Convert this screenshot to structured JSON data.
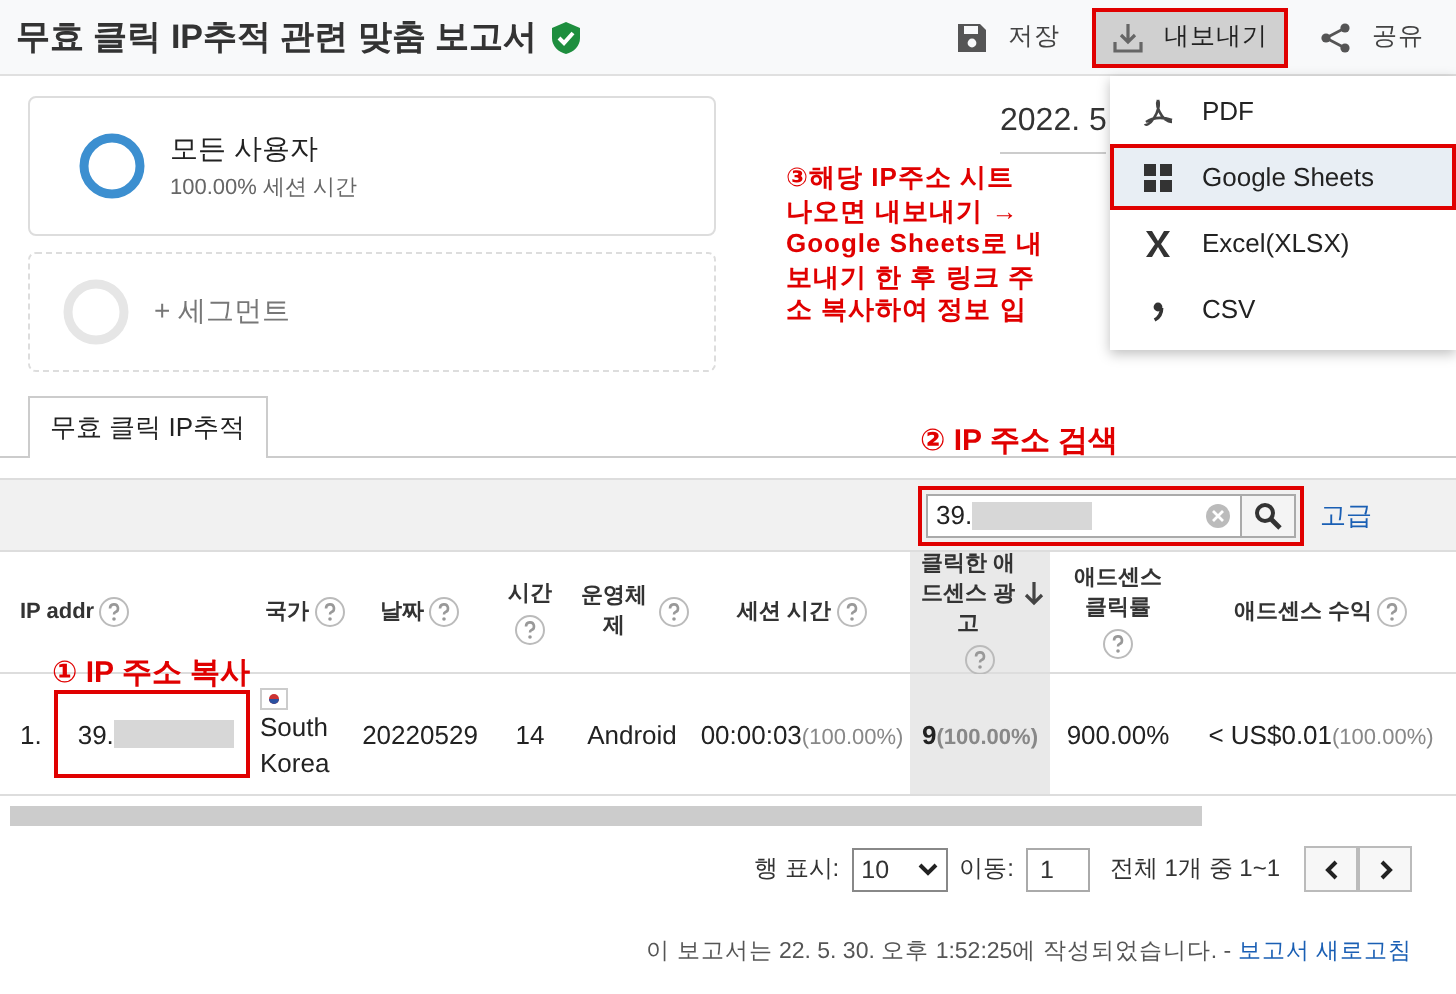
{
  "header": {
    "title": "무효 클릭 IP추적 관련 맞춤 보고서",
    "verified": true,
    "actions": [
      {
        "kind": "save",
        "label": "저장",
        "selected": false,
        "annotated": false
      },
      {
        "kind": "export",
        "label": "내보내기",
        "selected": true,
        "annotated": true
      },
      {
        "kind": "share",
        "label": "공유",
        "selected": false,
        "annotated": false
      }
    ]
  },
  "segments": [
    {
      "kind": "active",
      "name": "모든 사용자",
      "detail": "100.00% 세션 시간"
    },
    {
      "kind": "add",
      "name": "+ 세그먼트"
    }
  ],
  "date_range": "2022. 5",
  "export_menu": {
    "items": [
      {
        "kind": "pdf",
        "label": "PDF",
        "selected": false,
        "annotated": false
      },
      {
        "kind": "sheets",
        "label": "Google Sheets",
        "selected": true,
        "annotated": true
      },
      {
        "kind": "excel",
        "label": "Excel(XLSX)",
        "selected": false,
        "annotated": false
      },
      {
        "kind": "csv",
        "label": "CSV",
        "selected": false,
        "annotated": false
      }
    ]
  },
  "annotations": [
    {
      "lines": [
        "③해당 IP주소 시트",
        "나오면 내보내기 →",
        "Google Sheets로 내",
        "보내기 한 후 링크 주",
        "소 복사하여 정보 입"
      ]
    },
    {
      "lines": [
        "② IP 주소 검색"
      ]
    },
    {
      "lines": [
        "① IP 주소 복사"
      ]
    }
  ],
  "tabs": [
    {
      "label": "무효 클릭 IP추적",
      "selected": true
    }
  ],
  "search": {
    "value": "39.",
    "redacted": true,
    "annotated": true
  },
  "advanced_link": "고급",
  "table": {
    "columns": [
      {
        "label": "IP addr",
        "sorted": false
      },
      {
        "label": "국가",
        "sorted": false
      },
      {
        "label": "날짜",
        "sorted": false
      },
      {
        "label": "시간",
        "sorted": false
      },
      {
        "label": "운영체제",
        "sorted": false
      },
      {
        "label": "세션 시간",
        "sorted": false
      },
      {
        "label": "클릭한 애드센스 광고",
        "sorted": true
      },
      {
        "label": "애드센스 클릭률",
        "sorted": false
      },
      {
        "label": "애드센스 수익",
        "sorted": false
      }
    ],
    "rows": [
      {
        "index": "1.",
        "ip": "39.",
        "redacted": true,
        "annotated": true,
        "country": "South Korea",
        "date": "20220529",
        "hour": "14",
        "os": "Android",
        "session": {
          "value": "00:00:03",
          "share": "(100.00%)"
        },
        "clicks": {
          "value": "9",
          "share": "(100.00%)"
        },
        "ctr": "900.00%",
        "revenue": {
          "value": "< US$0.01",
          "share": "(100.00%)"
        }
      }
    ]
  },
  "pager": {
    "rows_label": "행 표시:",
    "rows_value": "10",
    "goto_label": "이동:",
    "goto_value": "1",
    "range": "전체 1개 중 1~1"
  },
  "footer": {
    "text": "이 보고서는 22. 5. 30. 오후 1:52:25에 작성되었습니다. -",
    "link": "보고서 새로고침"
  }
}
